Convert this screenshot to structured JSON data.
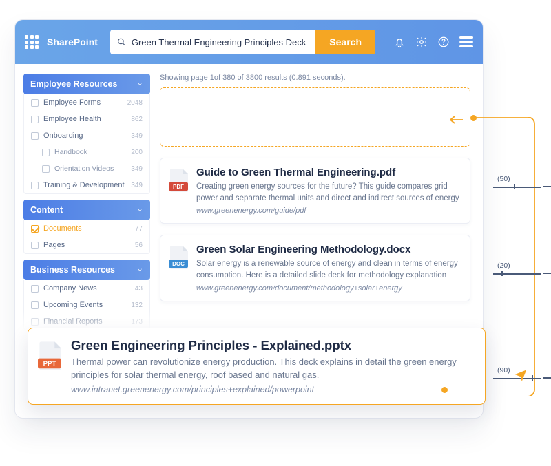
{
  "header": {
    "brand": "SharePoint",
    "search_value": "Green Thermal Engineering Principles Deck",
    "search_button": "Search"
  },
  "sidebar": {
    "facets": [
      {
        "title": "Employee Resources",
        "items": [
          {
            "label": "Employee Forms",
            "count": "2048"
          },
          {
            "label": "Employee Health",
            "count": "862"
          },
          {
            "label": "Onboarding",
            "count": "349"
          },
          {
            "label": "Handbook",
            "count": "200",
            "sub": true
          },
          {
            "label": "Orientation Videos",
            "count": "349",
            "sub": true
          },
          {
            "label": "Training & Development",
            "count": "349"
          }
        ]
      },
      {
        "title": "Content",
        "items": [
          {
            "label": "Documents",
            "count": "77",
            "selected": true
          },
          {
            "label": "Pages",
            "count": "56"
          }
        ]
      },
      {
        "title": "Business Resources",
        "items": [
          {
            "label": "Company News",
            "count": "43"
          },
          {
            "label": "Upcoming Events",
            "count": "132"
          },
          {
            "label": "Financial Reports",
            "count": "173"
          }
        ]
      }
    ]
  },
  "status": "Showing page 1of 380 of 3800 results (0.891 seconds).",
  "results": [
    {
      "title": "Guide to Green Thermal Engineering.pdf",
      "desc": "Creating green energy sources for the future? This guide compares grid power and separate thermal units and direct and indirect sources of energy",
      "url": "www.greenenergy.com/guide/pdf",
      "type": "PDF",
      "color": "#d44a3a"
    },
    {
      "title": "Green Solar Engineering Methodology.docx",
      "desc": "Solar energy is a renewable source of energy and clean in terms of energy consumption. Here is a detailed slide deck for methodology explanation",
      "url": "www.greenenergy.com/document/methodology+solar+energy",
      "type": "DOC",
      "color": "#3a8dd4"
    }
  ],
  "promoted": {
    "title": "Green Engineering Principles - Explained.pptx",
    "desc": "Thermal power can revolutionize energy production. This deck explains in detail the green energy principles for solar thermal energy, roof based and natural gas.",
    "url": "www.intranet.greenenergy.com/principles+explained/powerpoint",
    "type": "PPT",
    "color": "#e8683a"
  },
  "annotations": {
    "r1": "(50)",
    "r2": "(20)",
    "r3": "(90)"
  }
}
